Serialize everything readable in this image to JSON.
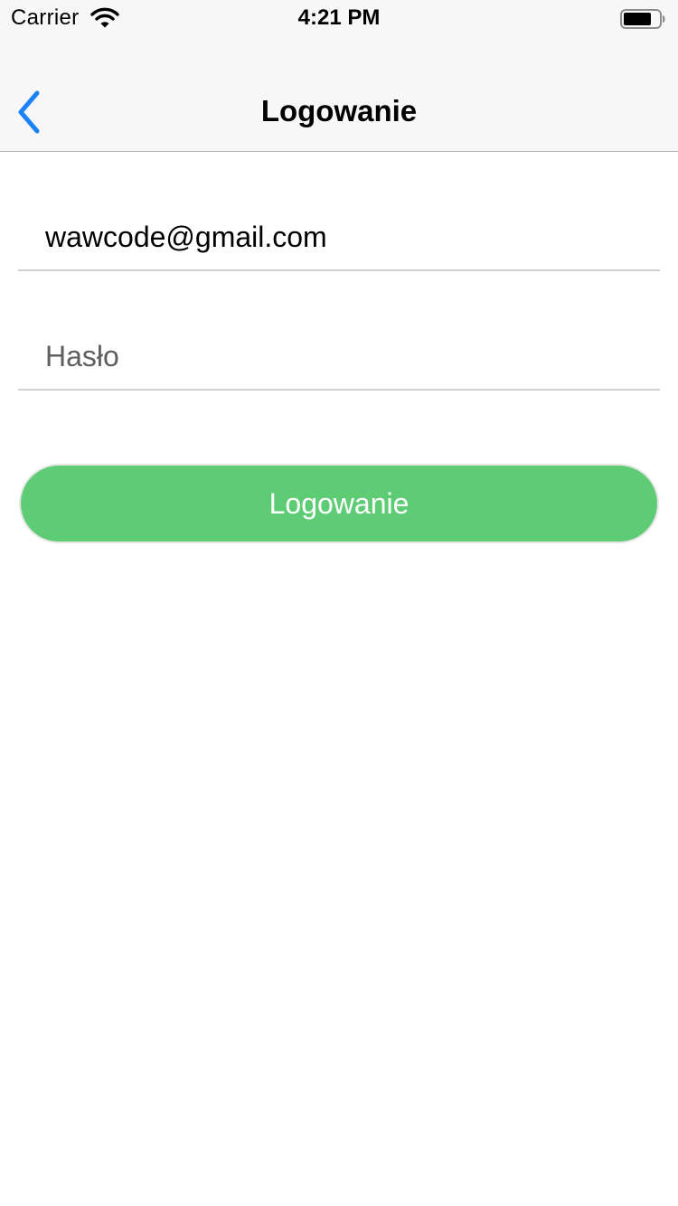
{
  "status_bar": {
    "carrier": "Carrier",
    "time": "4:21 PM",
    "wifi_icon": "wifi-icon",
    "battery_icon": "battery-icon",
    "battery_level": 0.8
  },
  "nav": {
    "back_icon": "chevron-left-icon",
    "title": "Logowanie",
    "accent_color": "#1a82fb"
  },
  "form": {
    "email": {
      "value": "wawcode@gmail.com",
      "placeholder": ""
    },
    "password": {
      "value": "",
      "placeholder": "Hasło"
    },
    "submit_label": "Logowanie",
    "submit_color": "#5ecc74"
  }
}
